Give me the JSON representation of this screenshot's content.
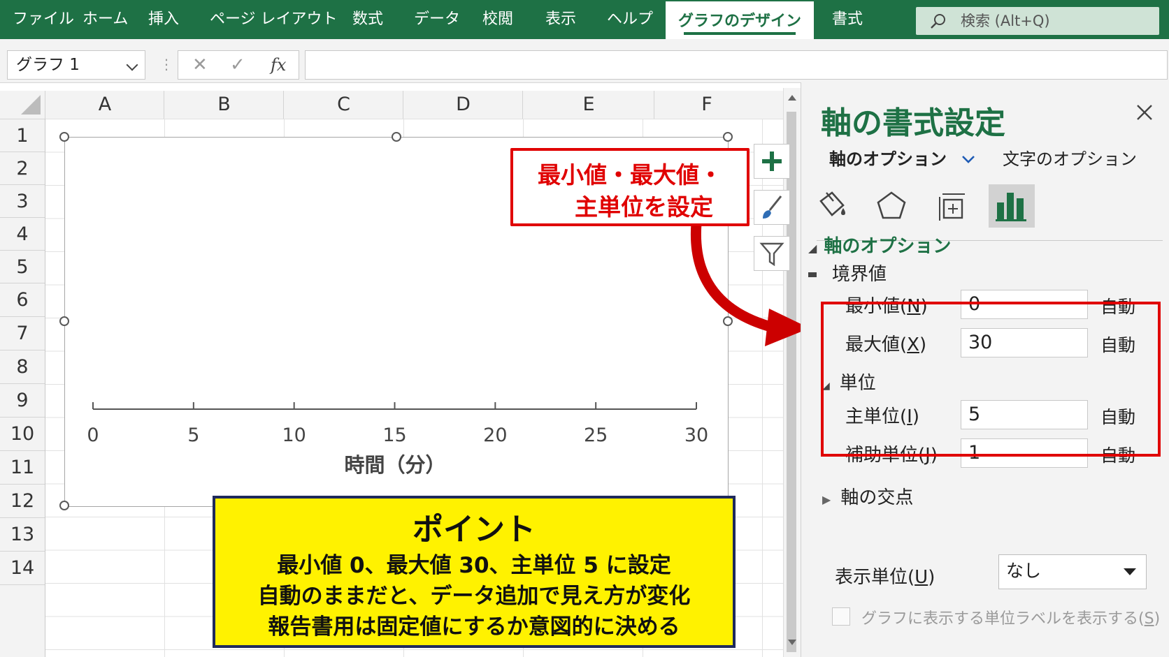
{
  "ribbon": {
    "tabs": [
      "ファイル",
      "ホーム",
      "挿入",
      "ページ レイアウト",
      "数式",
      "データ",
      "校閲",
      "表示",
      "ヘルプ"
    ],
    "active_tab": "グラフのデザイン",
    "format_tab": "書式",
    "search_placeholder": "検索 (Alt+Q)"
  },
  "formula_bar": {
    "name_box": "グラフ 1",
    "fx": "fx",
    "cancel_glyph": "✕",
    "confirm_glyph": "✓"
  },
  "grid": {
    "columns": [
      "A",
      "B",
      "C",
      "D",
      "E",
      "F"
    ],
    "rows": [
      "1",
      "2",
      "3",
      "4",
      "5",
      "6",
      "7",
      "8",
      "9",
      "10",
      "11",
      "12",
      "13",
      "14"
    ]
  },
  "chart_data": {
    "type": "line",
    "x": [],
    "series": [],
    "xlabel": "時間（分）",
    "xlim": [
      0,
      30
    ],
    "major_unit": 5,
    "x_ticks": [
      "0",
      "5",
      "10",
      "15",
      "20",
      "25",
      "30"
    ],
    "gridlines": false
  },
  "chart_buttons": {
    "add_icon": "plus-icon",
    "style_icon": "brush-icon",
    "filter_icon": "funnel-icon"
  },
  "callout": {
    "line1": "最小値・最大値・",
    "line2": "主単位を設定",
    "color": "#e00000"
  },
  "point": {
    "title": "ポイント",
    "line1": "最小値 0、最大値 30、主単位 5 に設定",
    "line2": "自動のままだと、データ追加で見え方が変化",
    "line3": "報告書用は固定値にするか意図的に決める",
    "background": "#fff200",
    "border": "#1f2a5c"
  },
  "pane": {
    "title": "軸の書式設定",
    "tab_axis_options": "軸のオプション",
    "tab_text_options": "文字のオプション",
    "icons": [
      "fill-bucket-icon",
      "pentagon-icon",
      "size-properties-icon",
      "bar-chart-icon"
    ],
    "section_axis_options": "軸のオプション",
    "bounds": {
      "label": "境界値",
      "min_label_pre": "最小値(",
      "min_key": "N",
      "min_value": "0",
      "max_label_pre": "最大値(",
      "max_key": "X",
      "max_value": "30",
      "close_paren": ")"
    },
    "units": {
      "label": "単位",
      "major_label_pre": "主単位(",
      "major_key": "I",
      "major_value": "5",
      "minor_label_pre": "補助単位(",
      "minor_key": "J",
      "minor_value": "1"
    },
    "auto_label": "自動",
    "cross_section": "軸の交点",
    "display_units_pre": "表示単位(",
    "display_units_key": "U",
    "display_units_value": "なし",
    "show_units_label_pre": "グラフに表示する単位ラベルを表示する(",
    "show_units_label_key": "S",
    "accent": "#1e7145"
  }
}
